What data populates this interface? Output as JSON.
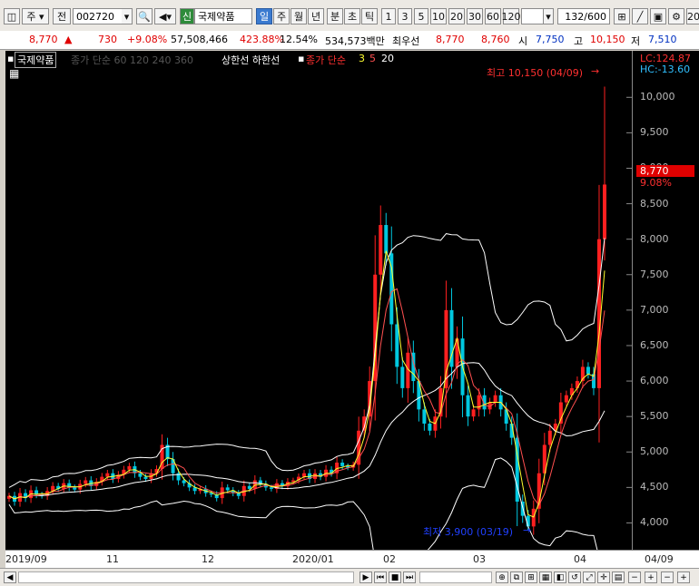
{
  "toolbar": {
    "market": "주",
    "prefix": "전",
    "code": "002720",
    "name_badge": "신",
    "name": "국제약품",
    "periods": [
      "일",
      "주",
      "월",
      "년"
    ],
    "intraday": [
      "분",
      "초",
      "틱"
    ],
    "intervals": [
      "1",
      "3",
      "5",
      "10",
      "20",
      "30",
      "60",
      "120"
    ],
    "count": "132",
    "count_max": "/600",
    "cut_label": "20"
  },
  "quote": {
    "price": "8,770",
    "change": "730",
    "change_pct": "+9.08%",
    "volume": "57,508,466",
    "volume_ratio": "423.88%",
    "turnover": "12.54%",
    "amount": "534,573백만",
    "ask_label": "최우선",
    "ask": "8,770",
    "bid": "8,760",
    "open_label": "시",
    "open": "7,750",
    "high_label": "고",
    "high": "10,150",
    "low_label": "저",
    "low": "7,510"
  },
  "legend": {
    "stock": "국제약품",
    "ma_long": "종가 단순 60 120 240 360",
    "limits": "상한선 하한선",
    "ma_short_title": "종가 단순",
    "ma3": "3",
    "ma5": "5",
    "ma20": "20"
  },
  "annotations": {
    "high": "최고 10,150 (04/09)",
    "low": "최저 3,900 (03/19)",
    "lc": "LC:124.87",
    "hc": "HC:-13.60",
    "current_price": "8,770",
    "current_pct": "9.08%"
  },
  "colors": {
    "up": "#ff2020",
    "down": "#00c8e0",
    "ma3": "#ffff30",
    "ma5": "#ff5050",
    "band": "#ffffff"
  },
  "chart_data": {
    "type": "candlestick",
    "ylim": [
      3750,
      10400
    ],
    "yticks": [
      4000,
      4500,
      5000,
      5500,
      6000,
      6500,
      7000,
      7500,
      8000,
      8500,
      9000,
      9500,
      10000
    ],
    "xlabels": [
      "2019/09",
      "11",
      "12",
      "2020/01",
      "02",
      "03",
      "04",
      "04/09"
    ],
    "close": [
      4380,
      4300,
      4420,
      4350,
      4460,
      4400,
      4380,
      4450,
      4520,
      4480,
      4560,
      4500,
      4470,
      4550,
      4600,
      4520,
      4580,
      4650,
      4700,
      4620,
      4680,
      4750,
      4800,
      4700,
      4650,
      4620,
      4700,
      4760,
      5100,
      4900,
      4700,
      4600,
      4560,
      4500,
      4450,
      4480,
      4420,
      4400,
      4350,
      4500,
      4460,
      4420,
      4380,
      4520,
      4480,
      4600,
      4550,
      4500,
      4480,
      4560,
      4520,
      4580,
      4600,
      4650,
      4700,
      4620,
      4700,
      4650,
      4750,
      4700,
      4850,
      4800,
      4780,
      4820,
      5300,
      5500,
      6000,
      7500,
      8200,
      7800,
      6800,
      6200,
      5900,
      6400,
      6000,
      5600,
      5400,
      5300,
      5500,
      5900,
      7000,
      6200,
      6600,
      5800,
      5500,
      5600,
      5800,
      5600,
      5700,
      5800,
      5600,
      5400,
      5200,
      4300,
      4100,
      3950,
      4200,
      4700,
      5100,
      5300,
      5400,
      5700,
      5800,
      5900,
      6000,
      6200,
      6100,
      5900,
      8000,
      8770
    ]
  }
}
